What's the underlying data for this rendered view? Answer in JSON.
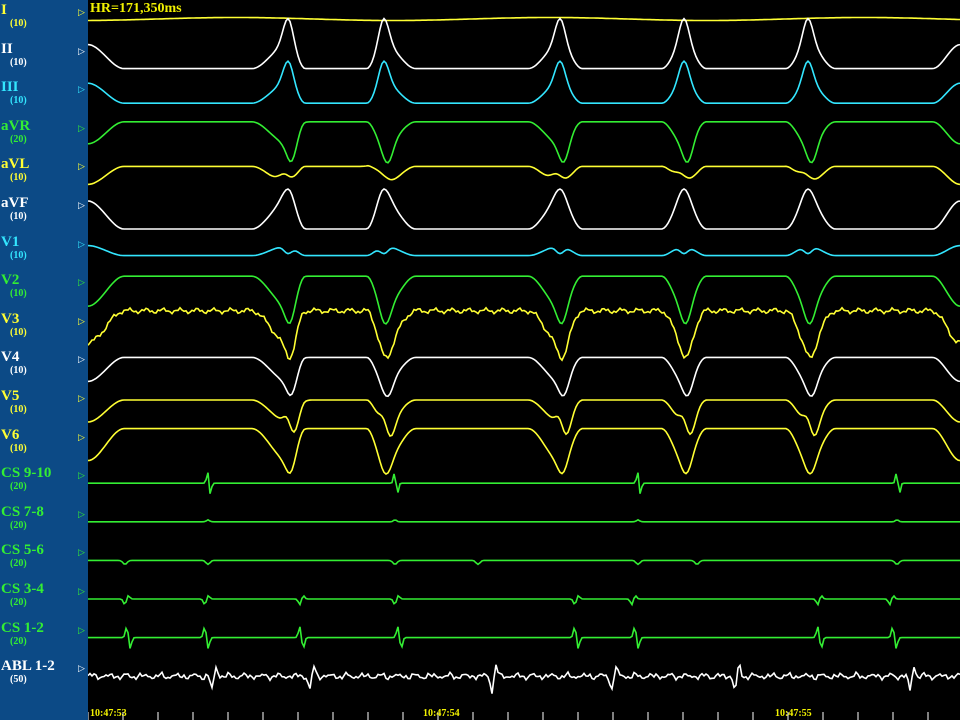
{
  "heart_rate": "HR=171,350ms",
  "channels": [
    {
      "name": "I",
      "gain": "(10)",
      "color": "#ffff33"
    },
    {
      "name": "II",
      "gain": "(10)",
      "color": "#ffffff"
    },
    {
      "name": "III",
      "gain": "(10)",
      "color": "#33e6ff"
    },
    {
      "name": "aVR",
      "gain": "(20)",
      "color": "#33ee33"
    },
    {
      "name": "aVL",
      "gain": "(10)",
      "color": "#ffff33"
    },
    {
      "name": "aVF",
      "gain": "(10)",
      "color": "#ffffff"
    },
    {
      "name": "V1",
      "gain": "(10)",
      "color": "#33e6ff"
    },
    {
      "name": "V2",
      "gain": "(10)",
      "color": "#33ee33"
    },
    {
      "name": "V3",
      "gain": "(10)",
      "color": "#ffff33"
    },
    {
      "name": "V4",
      "gain": "(10)",
      "color": "#ffffff"
    },
    {
      "name": "V5",
      "gain": "(10)",
      "color": "#ffff33"
    },
    {
      "name": "V6",
      "gain": "(10)",
      "color": "#ffff33"
    },
    {
      "name": "CS 9-10",
      "gain": "(20)",
      "color": "#33ee33"
    },
    {
      "name": "CS 7-8",
      "gain": "(20)",
      "color": "#33ee33"
    },
    {
      "name": "CS 5-6",
      "gain": "(20)",
      "color": "#33ee33"
    },
    {
      "name": "CS 3-4",
      "gain": "(20)",
      "color": "#33ee33"
    },
    {
      "name": "CS 1-2",
      "gain": "(20)",
      "color": "#33ee33"
    },
    {
      "name": "ABL 1-2",
      "gain": "(50)",
      "color": "#ffffff"
    }
  ],
  "time_labels": [
    "10:47:53",
    "10:47:54",
    "10:47:55"
  ]
}
